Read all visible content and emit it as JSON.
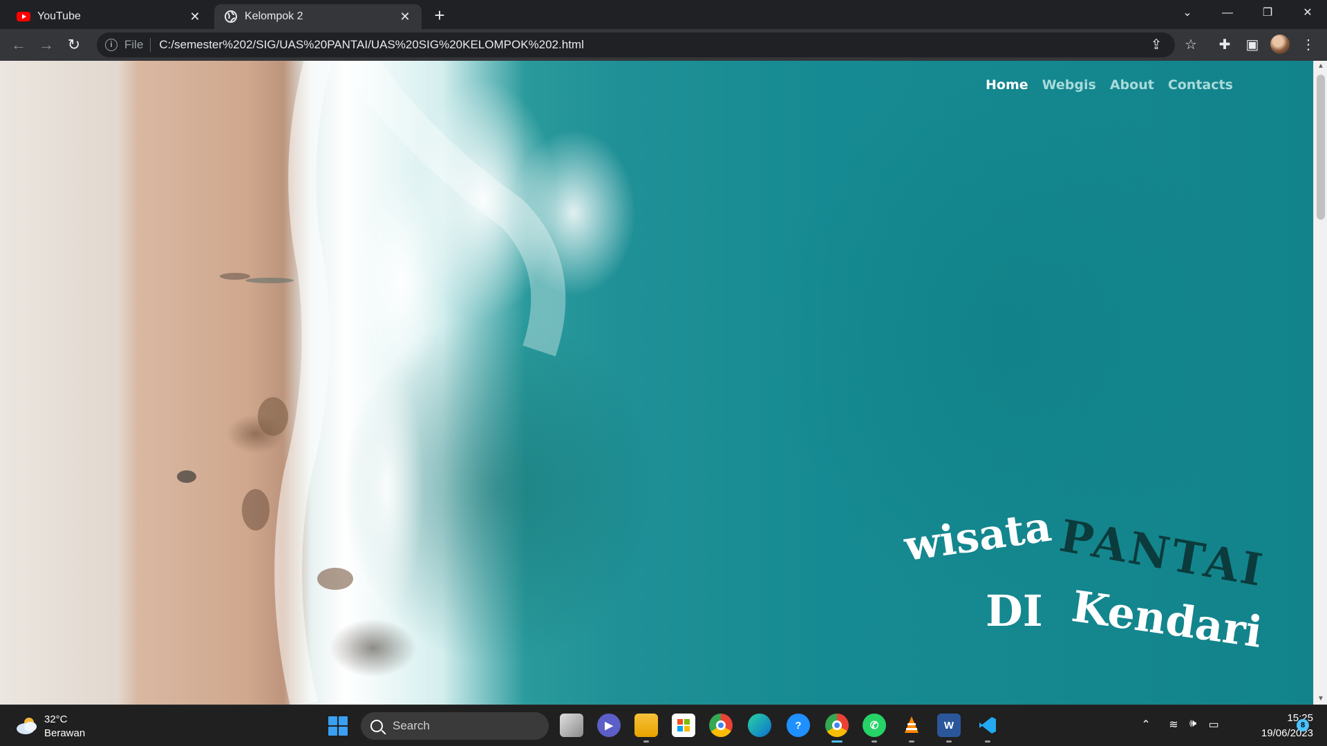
{
  "browser": {
    "tabs": [
      {
        "title": "YouTube",
        "active": false,
        "icon": "youtube-icon"
      },
      {
        "title": "Kelompok 2",
        "active": true,
        "icon": "globe-icon"
      }
    ],
    "address_bar": {
      "scheme_label": "File",
      "url": "C:/semester%202/SIG/UAS%20PANTAI/UAS%20SIG%20KELOMPOK%202.html"
    }
  },
  "page": {
    "nav": {
      "home": "Home",
      "webgis": "Webgis",
      "about": "About",
      "contacts": "Contacts"
    },
    "hero": {
      "word1": "wisata",
      "word2": "PANTAI",
      "word3": "DI",
      "word4": "Kendari"
    }
  },
  "taskbar": {
    "weather_temp": "32°C",
    "weather_desc": "Berawan",
    "search_placeholder": "Search",
    "time": "15:25",
    "date": "19/06/2023",
    "notification_count": "8"
  },
  "colors": {
    "nav_active": "#ffffff",
    "nav_inactive": "#a9dbdc",
    "hero_light": "#ffffff",
    "hero_dark": "#0b3b3c"
  }
}
